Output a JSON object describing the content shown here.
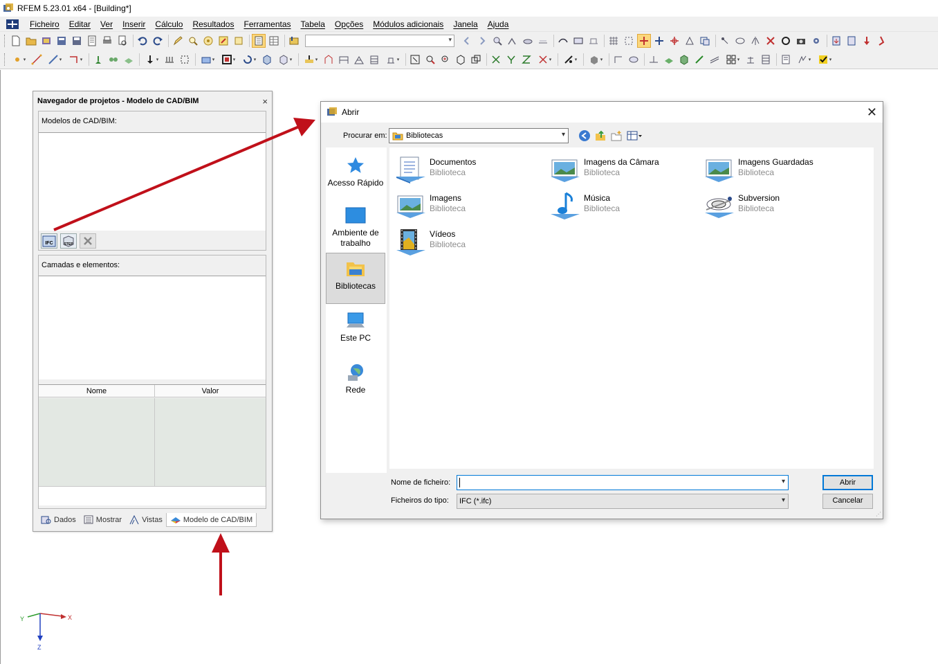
{
  "window": {
    "title": "RFEM 5.23.01 x64 - [Building*]"
  },
  "menu": [
    "Ficheiro",
    "Editar",
    "Ver",
    "Inserir",
    "Cálculo",
    "Resultados",
    "Ferramentas",
    "Tabela",
    "Opções",
    "Módulos adicionais",
    "Janela",
    "Ajuda"
  ],
  "navigator": {
    "title": "Navegador de projetos - Modelo de CAD/BIM",
    "close_glyph": "×",
    "models_label": "Modelos de CAD/BIM:",
    "ifc_button": "IFC",
    "step_button": "STEP",
    "layers_label": "Camadas e elementos:",
    "columns": {
      "name": "Nome",
      "value": "Valor"
    },
    "tabs": [
      {
        "label": "Dados",
        "icon": "data-icon"
      },
      {
        "label": "Mostrar",
        "icon": "display-icon"
      },
      {
        "label": "Vistas",
        "icon": "views-icon"
      },
      {
        "label": "Modelo de CAD/BIM",
        "icon": "cad-bim-icon"
      }
    ],
    "active_tab": "Modelo de CAD/BIM"
  },
  "dialog": {
    "title": "Abrir",
    "close_glyph": "✕",
    "look_in_label": "Procurar em:",
    "look_in_value": "Bibliotecas",
    "places": [
      "Acesso Rápido",
      "Ambiente de trabalho",
      "Bibliotecas",
      "Este PC",
      "Rede"
    ],
    "selected_place": "Bibliotecas",
    "items": [
      {
        "name": "Documentos",
        "type": "Biblioteca",
        "icon": "documents-library-icon"
      },
      {
        "name": "Imagens da Câmara",
        "type": "Biblioteca",
        "icon": "camera-roll-library-icon"
      },
      {
        "name": "Imagens Guardadas",
        "type": "Biblioteca",
        "icon": "saved-pictures-library-icon"
      },
      {
        "name": "Imagens",
        "type": "Biblioteca",
        "icon": "pictures-library-icon"
      },
      {
        "name": "Música",
        "type": "Biblioteca",
        "icon": "music-library-icon"
      },
      {
        "name": "Subversion",
        "type": "Biblioteca",
        "icon": "subversion-library-icon"
      },
      {
        "name": "Vídeos",
        "type": "Biblioteca",
        "icon": "videos-library-icon"
      }
    ],
    "filename_label": "Nome de ficheiro:",
    "filename_value": "",
    "filetype_label": "Ficheiros do tipo:",
    "filetype_value": "IFC (*.ifc)",
    "open_button": "Abrir",
    "cancel_button": "Cancelar"
  },
  "axis": {
    "x": "X",
    "y": "Y",
    "z": "Z"
  },
  "colors": {
    "annotation_arrow": "#c0101a",
    "accent": "#0078d7"
  }
}
